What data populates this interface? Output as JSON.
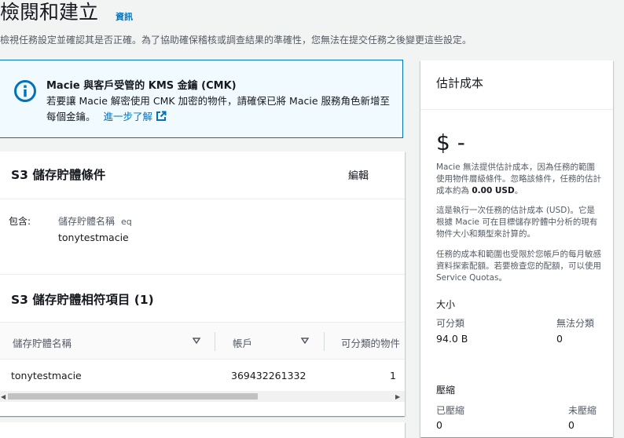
{
  "page": {
    "title": "檢閱和建立",
    "info_link": "資訊",
    "subtitle": "檢視任務設定並確認其是否正確。為了協助確保稽核或調查結果的準確性，您無法在提交任務之後變更這些設定。"
  },
  "alert": {
    "title": "Macie 與客戶受管的 KMS 金鑰 (CMK)",
    "body": "若要讓 Macie 解密使用 CMK 加密的物件，請確保已將 Macie 服務角色新增至每個金鑰。",
    "link": "進一步了解"
  },
  "bucket_criteria": {
    "heading": "S3 儲存貯體條件",
    "edit_label": "編輯",
    "include_label": "包含:",
    "key": "儲存貯體名稱",
    "operator": "eq",
    "value": "tonytestmacie"
  },
  "matching": {
    "heading": "S3 儲存貯體相符項目 (1)",
    "columns": [
      "儲存貯體名稱",
      "帳戶",
      "可分類的物件"
    ],
    "rows": [
      {
        "name": "tonytestmacie",
        "account": "369432261332",
        "objects": "1"
      }
    ]
  },
  "cost": {
    "heading": "估計成本",
    "price": "$ -",
    "note1_prefix": "Macie 無法提供估計成本，因為任務的範圍使用物件層級條件。忽略該條件，任務的估計成本約為 ",
    "note1_amount": "0.00 USD",
    "note1_suffix": "。",
    "note2": "這是執行一次任務的估計成本 (USD)。它是根據 Macie 可在目標儲存貯體中分析的現有物件大小和類型來計算的。",
    "note3": "任務的成本和範圍也受限於您帳戶的每月敏感資料探索配額。若要檢查您的配額，可以使用 Service Quotas。",
    "size_label": "大小",
    "classifiable_label": "可分類",
    "classifiable_value": "94.0 B",
    "unclassifiable_label": "無法分類",
    "unclassifiable_value": "0",
    "compressed_section": "壓縮",
    "compressed_label": "已壓縮",
    "compressed_value": "0",
    "uncompressed_label": "未壓縮",
    "uncompressed_value": "0"
  },
  "colors": {
    "link": "#0073bb",
    "alert_bg": "#f1faff",
    "alert_border": "#0073bb",
    "page_bg": "#f2f3f3"
  }
}
